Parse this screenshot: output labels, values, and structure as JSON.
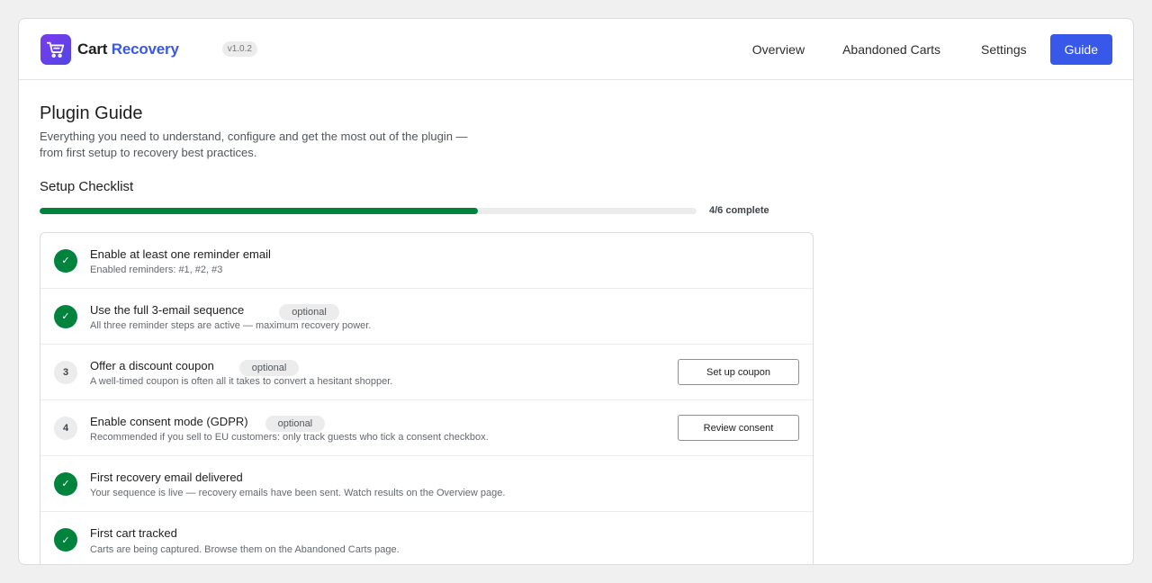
{
  "header": {
    "logo_icon": "shopping-cart-icon",
    "brand_part1": "Cart",
    "brand_part2": "Recovery",
    "version": "v1.0.2",
    "nav": {
      "overview": "Overview",
      "abandoned_carts": "Abandoned Carts",
      "settings": "Settings",
      "guide": "Guide"
    },
    "active_tab": "Guide"
  },
  "page": {
    "title": "Plugin Guide",
    "subtitle": "Everything you need to understand, configure and get the most out of the plugin — from first setup to recovery best practices."
  },
  "checklist": {
    "title": "Setup Checklist",
    "progress_fraction": 0.6667,
    "progress_label": "4/6 complete",
    "items": [
      {
        "status": "done",
        "check_glyph": "✓",
        "title": "Enable at least one reminder email",
        "description": "Enabled reminders: #1, #2, #3"
      },
      {
        "status": "done",
        "check_glyph": "✓",
        "title": "Use the full 3-email sequence",
        "tag": "optional",
        "description": "All three reminder steps are active — maximum recovery power."
      },
      {
        "status": "todo",
        "number": "3",
        "title": "Offer a discount coupon",
        "tag": "optional",
        "description": "A well-timed coupon is often all it takes to convert a hesitant shopper.",
        "action": "Set up coupon"
      },
      {
        "status": "todo",
        "number": "4",
        "title": "Enable consent mode (GDPR)",
        "tag": "optional",
        "description": "Recommended if you sell to EU customers: only track guests who tick a consent checkbox.",
        "action": "Review consent"
      },
      {
        "status": "done",
        "check_glyph": "✓",
        "title": "First recovery email delivered",
        "description": "Your sequence is live — recovery emails have been sent. Watch results on the Overview page."
      },
      {
        "status": "done",
        "check_glyph": "✓",
        "title": "First cart tracked",
        "description": "Carts are being captured. Browse them on the Abandoned Carts page."
      }
    ]
  },
  "colors": {
    "accent": "#3858e9",
    "success": "#00843d",
    "logo_gradient_start": "#7c3aed",
    "logo_gradient_end": "#4f46e5"
  }
}
